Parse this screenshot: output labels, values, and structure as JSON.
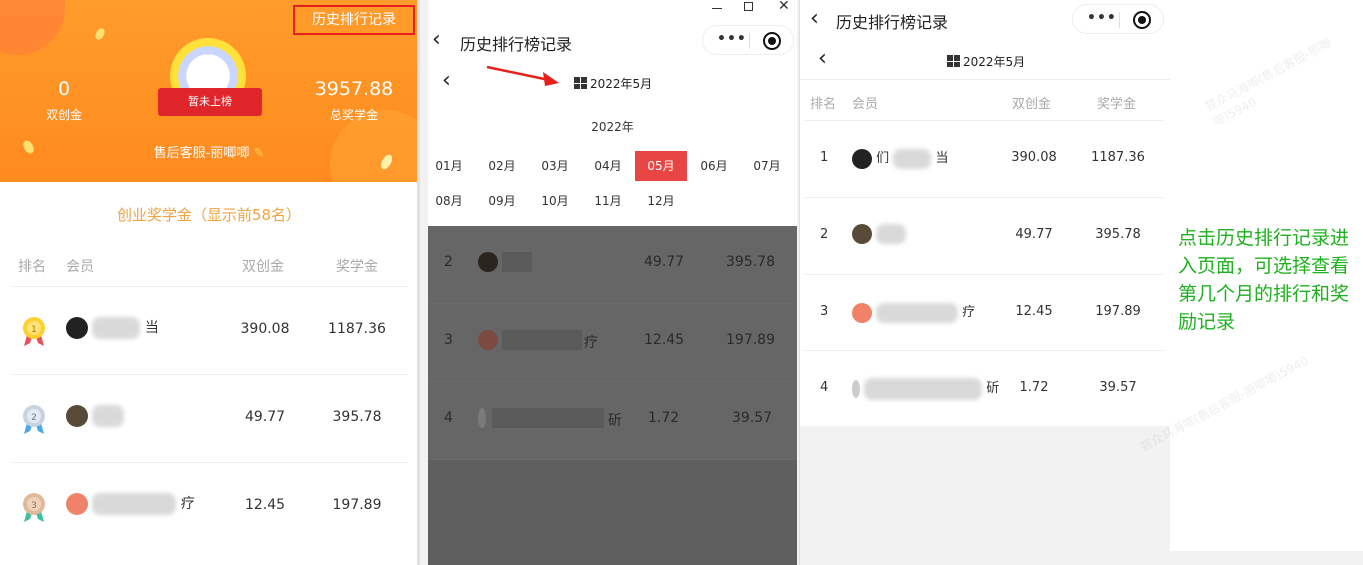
{
  "panel1": {
    "history_button": "历史排行记录",
    "left_stat": {
      "value": "0",
      "label": "双创金"
    },
    "right_stat": {
      "value": "3957.88",
      "label": "总奖学金"
    },
    "rank_badge": "暂未上榜",
    "service": "售后客服-丽唧唧",
    "section_title": "创业奖学金（显示前58名）",
    "headers": [
      "排名",
      "会员",
      "双创金",
      "奖学金"
    ],
    "rows": [
      {
        "member_suffix": "当",
        "shuangchuang": "390.08",
        "scholarship": "1187.36",
        "avatar_color": "#222222"
      },
      {
        "member_suffix": "",
        "shuangchuang": "49.77",
        "scholarship": "395.78",
        "avatar_color": "#5a4a3a"
      },
      {
        "member_suffix": "疗",
        "shuangchuang": "12.45",
        "scholarship": "197.89",
        "avatar_color": "#f0826a"
      }
    ]
  },
  "panel2": {
    "nav_title": "历史排行榜记录",
    "date": "2022年5月",
    "year": "2022年",
    "months": [
      "01月",
      "02月",
      "03月",
      "04月",
      "05月",
      "06月",
      "07月",
      "08月",
      "09月",
      "10月",
      "11月",
      "12月"
    ],
    "active_month_index": 4,
    "rows": [
      {
        "rank": "2",
        "member_suffix": "",
        "shuangchuang": "49.77",
        "scholarship": "395.78"
      },
      {
        "rank": "3",
        "member_suffix": "疗",
        "shuangchuang": "12.45",
        "scholarship": "197.89"
      },
      {
        "rank": "4",
        "member_suffix": "斫",
        "shuangchuang": "1.72",
        "scholarship": "39.57"
      }
    ]
  },
  "panel3": {
    "nav_title": "历史排行榜记录",
    "date": "2022年5月",
    "headers": [
      "排名",
      "会员",
      "双创金",
      "奖学金"
    ],
    "rows": [
      {
        "rank": "1",
        "member_prefix": "们",
        "member_suffix": "当",
        "shuangchuang": "390.08",
        "scholarship": "1187.36",
        "avatar_color": "#222222"
      },
      {
        "rank": "2",
        "member_prefix": "",
        "member_suffix": "",
        "shuangchuang": "49.77",
        "scholarship": "395.78",
        "avatar_color": "#5a4a3a"
      },
      {
        "rank": "3",
        "member_prefix": "",
        "member_suffix": "疗",
        "shuangchuang": "12.45",
        "scholarship": "197.89",
        "avatar_color": "#f0826a"
      },
      {
        "rank": "4",
        "member_prefix": "",
        "member_suffix": "斫",
        "shuangchuang": "1.72",
        "scholarship": "39.57",
        "avatar_color": "#cccccc"
      }
    ]
  },
  "note": "点击历史排行记录进入页面，可选择查看第几个月的排行和奖励记录",
  "watermark": "芸众马海唧(售后客服-丽唧唧)5940",
  "colors": {
    "orange": "#ff8a1e",
    "active_month": "#e84545",
    "note_green": "#1fb11f",
    "highlight_box": "#e6201a"
  }
}
